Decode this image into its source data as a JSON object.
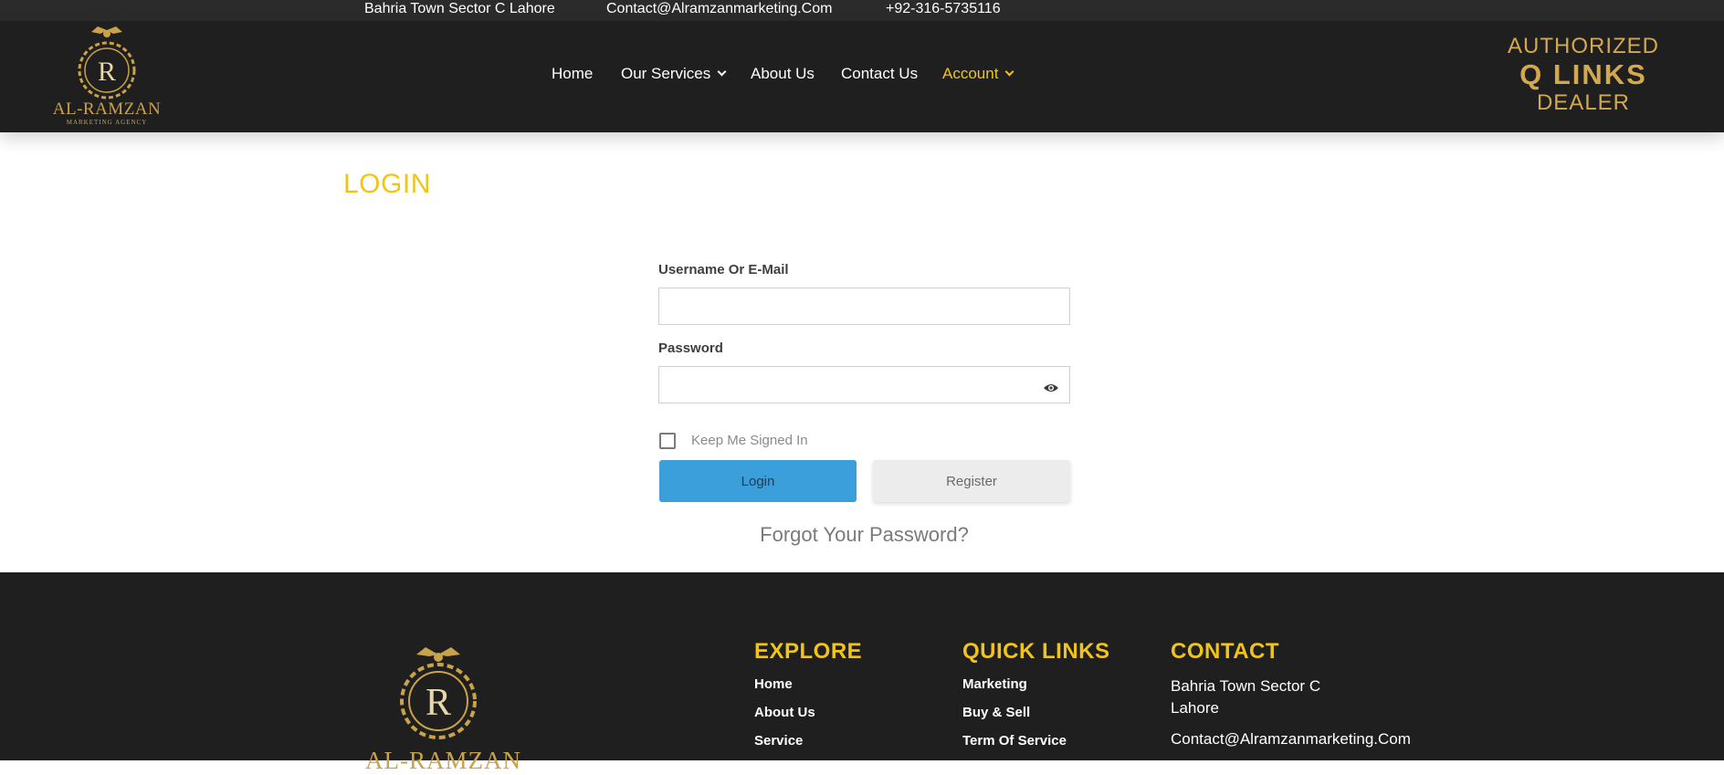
{
  "topbar": {
    "address": "Bahria Town Sector C Lahore",
    "email": "Contact@Alramzanmarketing.Com",
    "phone": "+92-316-5735116"
  },
  "logo": {
    "name": "AL-RAMZAN",
    "tagline": "MARKETING AGENCY",
    "letter": "R"
  },
  "nav": {
    "items": [
      {
        "label": "Home"
      },
      {
        "label": "Our Services"
      },
      {
        "label": "About Us"
      },
      {
        "label": "Contact Us"
      },
      {
        "label": "Account"
      }
    ]
  },
  "dealer_badge": {
    "line1": "AUTHORIZED",
    "line2": "Q LINKS",
    "line3": "DEALER"
  },
  "page": {
    "title": "LOGIN"
  },
  "login_form": {
    "username_label": "Username Or E-Mail",
    "username_value": "",
    "password_label": "Password",
    "password_value": "",
    "keep_signed_in_label": "Keep Me Signed In",
    "keep_signed_in_checked": false,
    "login_button": "Login",
    "register_button": "Register",
    "forgot_link": "Forgot Your Password?"
  },
  "footer": {
    "logo_name": "AL-RAMZAN",
    "explore": {
      "heading": "EXPLORE",
      "links": [
        "Home",
        "About Us",
        "Service"
      ]
    },
    "quick_links": {
      "heading": "QUICK LINKS",
      "links": [
        "Marketing",
        "Buy & Sell",
        "Term Of Service"
      ]
    },
    "contact": {
      "heading": "CONTACT",
      "address_line1": "Bahria Town Sector C",
      "address_line2": "Lahore",
      "email": "Contact@Alramzanmarketing.Com"
    }
  },
  "colors": {
    "accent": "#f0c419",
    "gold": "#c9a24a",
    "header_bg": "#1f1f1f",
    "login_button": "#3a9fdb"
  }
}
